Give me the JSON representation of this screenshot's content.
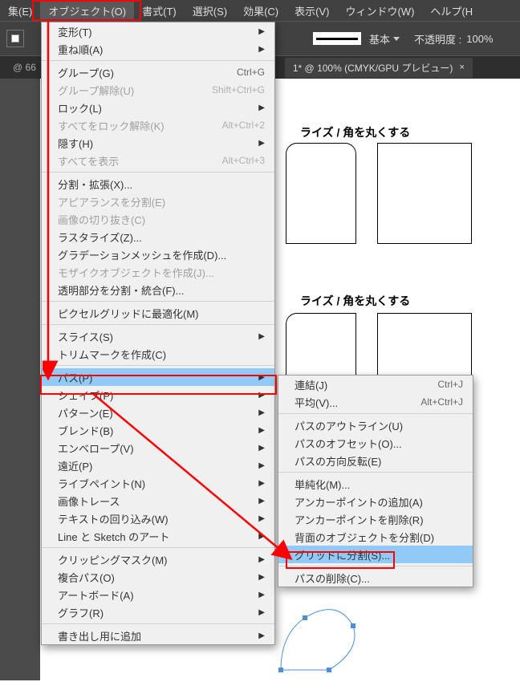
{
  "menubar": {
    "items": [
      "集(E)",
      "オブジェクト(O)",
      "書式(T)",
      "選択(S)",
      "効果(C)",
      "表示(V)",
      "ウィンドウ(W)",
      "ヘルプ(H"
    ]
  },
  "toolbar": {
    "basic": "基本",
    "opacity_label": "不透明度 :",
    "opacity_value": "100%"
  },
  "tabs": {
    "left": "@ 66",
    "active": "1* @ 100% (CMYK/GPU プレビュー)",
    "close": "×"
  },
  "headings": {
    "h1": "ライズ / 角を丸くする",
    "h2": "ライズ / 角を丸くする"
  },
  "object_menu": {
    "transform": "変形(T)",
    "arrange": "重ね順(A)",
    "group": "グループ(G)",
    "group_sc": "Ctrl+G",
    "ungroup": "グループ解除(U)",
    "ungroup_sc": "Shift+Ctrl+G",
    "lock": "ロック(L)",
    "unlock_all": "すべてをロック解除(K)",
    "unlock_all_sc": "Alt+Ctrl+2",
    "hide": "隠す(H)",
    "show_all": "すべてを表示",
    "show_all_sc": "Alt+Ctrl+3",
    "expand": "分割・拡張(X)...",
    "expand_appearance": "アピアランスを分割(E)",
    "crop_image": "画像の切り抜き(C)",
    "rasterize": "ラスタライズ(Z)...",
    "gradient_mesh": "グラデーションメッシュを作成(D)...",
    "mosaic": "モザイクオブジェクトを作成(J)...",
    "flatten": "透明部分を分割・統合(F)...",
    "pixel_grid": "ピクセルグリッドに最適化(M)",
    "slice": "スライス(S)",
    "trim_marks": "トリムマークを作成(C)",
    "path": "パス(P)",
    "shape": "シェイプ(P)",
    "pattern": "パターン(E)",
    "blend": "ブレンド(B)",
    "envelope": "エンベロープ(V)",
    "perspective": "遠近(P)",
    "live_paint": "ライブペイント(N)",
    "image_trace": "画像トレース",
    "text_wrap": "テキストの回り込み(W)",
    "line_sketch": "Line と Sketch のアート",
    "clipping_mask": "クリッピングマスク(M)",
    "compound_path": "複合パス(O)",
    "artboard": "アートボード(A)",
    "graph": "グラフ(R)",
    "export_add": "書き出し用に追加"
  },
  "path_submenu": {
    "join": "連結(J)",
    "join_sc": "Ctrl+J",
    "average": "平均(V)...",
    "average_sc": "Alt+Ctrl+J",
    "outline": "パスのアウトライン(U)",
    "offset": "パスのオフセット(O)...",
    "reverse": "パスの方向反転(E)",
    "simplify": "単純化(M)...",
    "add_anchor": "アンカーポイントの追加(A)",
    "remove_anchor": "アンカーポイントを削除(R)",
    "divide_below": "背面のオブジェクトを分割(D)",
    "split_grid": "グリッドに分割(S)...",
    "cleanup": "パスの削除(C)..."
  }
}
